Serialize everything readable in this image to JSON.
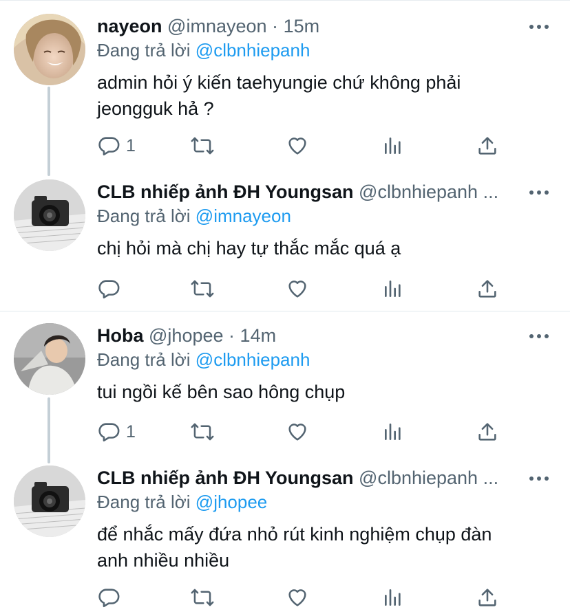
{
  "tweets": [
    {
      "name": "nayeon",
      "handle": "@imnayeon",
      "dot": "·",
      "time": "15m",
      "reply_prefix": "Đang trả lời",
      "reply_to": "@clbnhiepanh",
      "text_lines": [
        "admin hỏi ý kiến taehyungie chứ không phải",
        "jeongguk hả ?"
      ],
      "reply_count": "1",
      "avatar": "avatar-nayeon"
    },
    {
      "name": "CLB nhiếp ảnh ĐH Youngsan",
      "handle": "@clbnhiepanh ...",
      "reply_prefix": "Đang trả lời",
      "reply_to": "@imnayeon",
      "text_lines": [
        "chị hỏi mà chị hay tự thắc mắc quá ạ"
      ],
      "reply_count": "",
      "avatar": "avatar-camera"
    },
    {
      "name": "Hoba",
      "handle": "@jhopee",
      "dot": "·",
      "time": "14m",
      "reply_prefix": "Đang trả lời",
      "reply_to": "@clbnhiepanh",
      "text_lines": [
        "tui ngồi kế bên sao hông chụp"
      ],
      "reply_count": "1",
      "avatar": "avatar-hoba"
    },
    {
      "name": "CLB nhiếp ảnh ĐH Youngsan",
      "handle": "@clbnhiepanh ...",
      "reply_prefix": "Đang trả lời",
      "reply_to": "@jhopee",
      "text_lines": [
        "để nhắc mấy đứa nhỏ rút kinh nghiệm chụp đàn",
        "anh nhiều nhiều"
      ],
      "reply_count": "",
      "avatar": "avatar-camera"
    }
  ],
  "icons": {
    "reply": "speech-bubble-icon",
    "retweet": "retweet-icon",
    "like": "heart-icon",
    "views": "bar-chart-icon",
    "share": "share-icon",
    "more": "more-dots-icon"
  },
  "colors": {
    "link": "#1d9bf0",
    "secondary": "#536471",
    "icon": "#536471",
    "text": "#0f1419"
  }
}
